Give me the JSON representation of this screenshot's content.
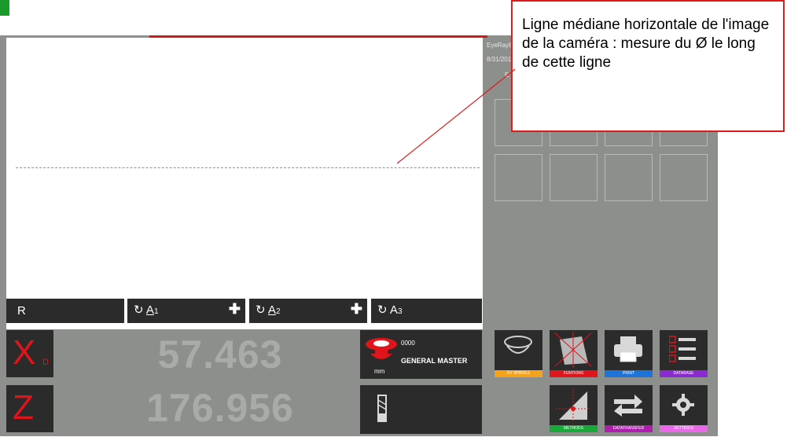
{
  "app": {
    "info_lines": [
      "EyeRay8",
      "8/31/201",
      "E"
    ]
  },
  "tabs": {
    "r": {
      "label": "R"
    },
    "a1": {
      "prefix": "↻",
      "letter": "A",
      "sub": "1",
      "plus": "✚"
    },
    "a2": {
      "prefix": "↻",
      "letter": "A",
      "sub": "2",
      "plus": "✚"
    },
    "a3": {
      "prefix": "↻",
      "letter": "A",
      "sub": "3"
    }
  },
  "axes": {
    "x": {
      "letter": "X",
      "sub": "D",
      "value": "57.463"
    },
    "z": {
      "letter": "Z",
      "value": "176.956"
    }
  },
  "master": {
    "code": "0000",
    "name": "GENERAL MASTER",
    "unit": "mm"
  },
  "functions": [
    {
      "label": "KV SPINDLE",
      "color": "#f5a21c",
      "icon": "spindle-icon"
    },
    {
      "label": "FUNTIONS",
      "color": "#e0141b",
      "icon": "functions-icon"
    },
    {
      "label": "PRINT",
      "color": "#1e73d8",
      "icon": "printer-icon"
    },
    {
      "label": "DATABASE",
      "color": "#8a2bd0",
      "icon": "list-icon"
    },
    {
      "label": "METHODS",
      "color": "#19a83a",
      "icon": "methods-icon"
    },
    {
      "label": "DATATRANSFER",
      "color": "#b01eb0",
      "icon": "transfer-icon"
    },
    {
      "label": "SETTINGS",
      "color": "#e86ae8",
      "icon": "gear-icon"
    }
  ],
  "callout": {
    "text": "Ligne médiane horizontale de l'image de la caméra : mesure du Ø le long de cette ligne"
  },
  "colors": {
    "accent_red": "#e0141b",
    "panel_dark": "#2b2b2b",
    "app_bg": "#8c8f8b"
  }
}
